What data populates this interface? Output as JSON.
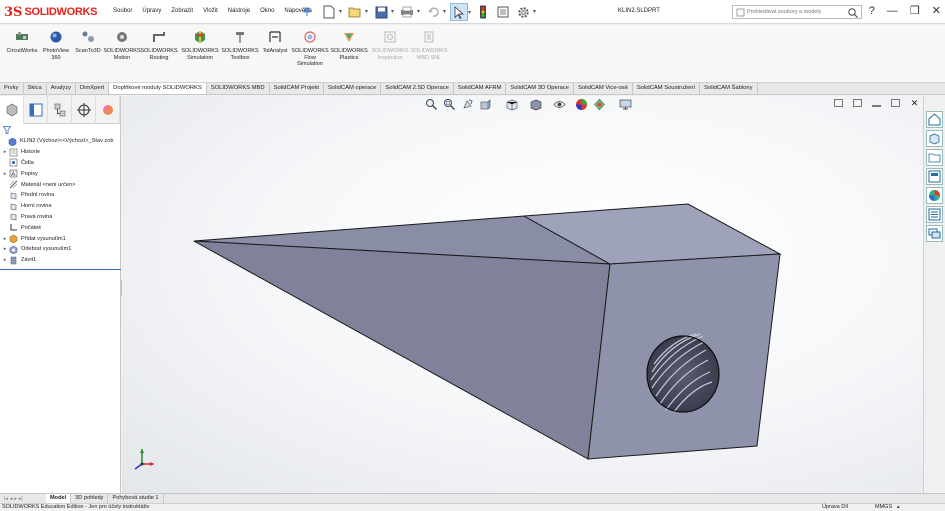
{
  "app": {
    "logo_mark": "3S",
    "logo_text": "SOLIDWORKS",
    "document_title": "KLIN2.SLDPRT"
  },
  "menu": [
    "Soubor",
    "Úpravy",
    "Zobrazit",
    "Vložit",
    "Nástroje",
    "Okno",
    "Nápověda"
  ],
  "search": {
    "placeholder": "Prohledávat soubory a modely"
  },
  "window_controls": [
    "?",
    "—",
    "❐",
    "✕"
  ],
  "commands": [
    {
      "label": "CircuitWorks",
      "icon": "circuitworks-icon",
      "enabled": true
    },
    {
      "label": "PhotoView\n360",
      "icon": "photoview-icon",
      "enabled": true
    },
    {
      "label": "ScanTo3D",
      "icon": "scanto3d-icon",
      "enabled": true
    },
    {
      "label": "SOLIDWORKS\nMotion",
      "icon": "motion-icon",
      "enabled": true
    },
    {
      "label": "SOLIDWORKS\nRouting",
      "icon": "routing-icon",
      "enabled": true
    },
    {
      "label": "SOLIDWORKS\nSimulation",
      "icon": "simulation-icon",
      "enabled": true
    },
    {
      "label": "SOLIDWORKS\nToolbox",
      "icon": "toolbox-icon",
      "enabled": true
    },
    {
      "label": "TolAnalyst",
      "icon": "tolanalyst-icon",
      "enabled": true
    },
    {
      "label": "SOLIDWORKS\nFlow\nSimulation",
      "icon": "flow-simulation-icon",
      "enabled": true
    },
    {
      "label": "SOLIDWORKS\nPlastics",
      "icon": "plastics-icon",
      "enabled": true
    },
    {
      "label": "SOLIDWORKS\nInspection",
      "icon": "inspection-icon",
      "enabled": false
    },
    {
      "label": "SOLIDWORKS\nMBD SNL",
      "icon": "mbd-snl-icon",
      "enabled": false
    }
  ],
  "tabs": [
    {
      "label": "Prvky",
      "active": false
    },
    {
      "label": "Skica",
      "active": false
    },
    {
      "label": "Analýzy",
      "active": false
    },
    {
      "label": "DimXpert",
      "active": false
    },
    {
      "label": "Doplňkové moduly SOLIDWORKS",
      "active": true
    },
    {
      "label": "SOLIDWORKS MBD",
      "active": false
    },
    {
      "label": "SolidCAM Projekt",
      "active": false
    },
    {
      "label": "SolidCAM operace",
      "active": false
    },
    {
      "label": "SolidCAM 2.5D Operace",
      "active": false
    },
    {
      "label": "SolidCAM AFRM",
      "active": false
    },
    {
      "label": "SolidCAM 3D Operace",
      "active": false
    },
    {
      "label": "SolidCAM Vice-osé",
      "active": false
    },
    {
      "label": "SolidCAM Soustružení",
      "active": false
    },
    {
      "label": "SolidCAM Šablony",
      "active": false
    }
  ],
  "tree": [
    {
      "label": "KLIN2  (Výchozí<<Výchozí>_Stav zob",
      "arrow": "",
      "icon": "part-icon",
      "indent": 0
    },
    {
      "label": "Historie",
      "arrow": "▸",
      "icon": "history-icon",
      "indent": 1
    },
    {
      "label": "Čidla",
      "arrow": "",
      "icon": "sensors-icon",
      "indent": 1
    },
    {
      "label": "Popisy",
      "arrow": "▸",
      "icon": "annotations-icon",
      "indent": 1
    },
    {
      "label": "Materiál <není určen>",
      "arrow": "",
      "icon": "material-icon",
      "indent": 1
    },
    {
      "label": "Přední rovina",
      "arrow": "",
      "icon": "plane-icon",
      "indent": 1
    },
    {
      "label": "Horní rovina",
      "arrow": "",
      "icon": "plane-icon",
      "indent": 1
    },
    {
      "label": "Pravá rovina",
      "arrow": "",
      "icon": "plane-icon",
      "indent": 1
    },
    {
      "label": "Počátek",
      "arrow": "",
      "icon": "origin-icon",
      "indent": 1
    },
    {
      "label": "Přidat vysunutím1",
      "arrow": "▸",
      "icon": "extrude-icon",
      "indent": 1
    },
    {
      "label": "Odebrat vysunutím1",
      "arrow": "▸",
      "icon": "cut-extrude-icon",
      "indent": 1
    },
    {
      "label": "Závit1",
      "arrow": "▸",
      "icon": "thread-icon",
      "indent": 1
    }
  ],
  "bottom_tabs": [
    {
      "label": "Model",
      "active": true
    },
    {
      "label": "3D pohledy",
      "active": false
    },
    {
      "label": "Pohybová studie 1",
      "active": false
    }
  ],
  "status": {
    "left": "SOLIDWORKS Education Edition - Jen pro účely instruktáže",
    "mode": "Úprava Díl",
    "units": "MMGS",
    "caret": "▴"
  },
  "colors": {
    "brand_red": "#e2231a",
    "model_face_top": "#9a9db3",
    "model_face_front": "#8b8ea5",
    "model_face_side": "#7c7f95",
    "edge": "#1a1a1a",
    "selection_blue": "#3b6fc4"
  }
}
